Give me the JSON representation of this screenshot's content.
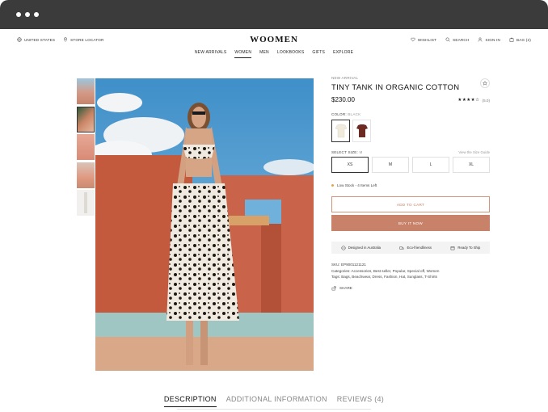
{
  "header": {
    "country": "United States",
    "store_locator": "Store Locator",
    "brand": "WOOMEN",
    "wishlist": "Wishlist",
    "search": "Search",
    "sign_in": "Sign In",
    "bag": "Bag (2)"
  },
  "nav": {
    "items": [
      "New Arrivals",
      "Women",
      "Men",
      "Lookbooks",
      "Gifts",
      "Explore"
    ],
    "active": "Women"
  },
  "product": {
    "badge": "New Arrival",
    "title": "Tiny Tank in Organic Cotton",
    "price": "$230.00",
    "rating_count": "(5.0)",
    "rating": 4,
    "color_label": "Color:",
    "color_value": "Black",
    "size_label": "Select Size:",
    "size_value": "M",
    "size_guide": "View the Size Guide",
    "sizes": [
      "XS",
      "M",
      "L",
      "XL"
    ],
    "selected_size": "XS",
    "stock": "Low Stock - 4 Items Left",
    "add_to_cart": "Add to Cart",
    "buy_now": "Buy it now",
    "features": [
      "Designed in Australia",
      "Eco-friendliness",
      "Ready To Ship"
    ],
    "sku": "SKU: EP9001121121",
    "categories": "Categories: Accessories, Best seller, Popular, Special off, Women",
    "tags": "Tags: Bags, Beachwear, Dress, Fashion, Hat, Sunglass, T-Shirts",
    "share": "Share"
  },
  "tabs": {
    "items": [
      "Description",
      "Additional Information",
      "Reviews (4)"
    ],
    "active": "Description"
  },
  "colors": {
    "accent": "#c8826a",
    "accent_border": "#d29379",
    "stock_dot": "#e0a74b",
    "chrome": "#3b3b3b"
  }
}
